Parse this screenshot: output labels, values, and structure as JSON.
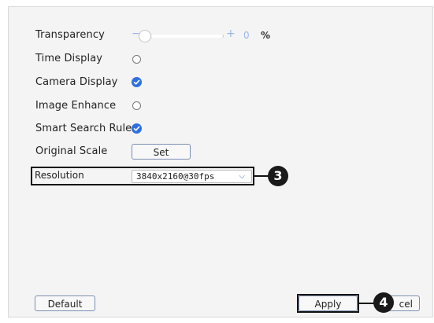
{
  "settings": {
    "transparency": {
      "label": "Transparency",
      "minus": "−",
      "plus": "+",
      "value": "0",
      "unit": "%",
      "level": 0
    },
    "time_display": {
      "label": "Time Display",
      "checked": false
    },
    "camera_display": {
      "label": "Camera Display",
      "checked": true
    },
    "image_enhance": {
      "label": "Image Enhance",
      "checked": false
    },
    "smart_search_rule": {
      "label": "Smart Search Rule",
      "checked": true
    },
    "original_scale": {
      "label": "Original Scale",
      "button": "Set"
    },
    "resolution": {
      "label": "Resolution",
      "selected": "3840x2160@30fps"
    }
  },
  "footer": {
    "default_label": "Default",
    "apply_label": "Apply",
    "cancel_label": "cel"
  },
  "callouts": {
    "resolution": "3",
    "apply": "4"
  },
  "colors": {
    "accent": "#2f6fe0",
    "badge": "#1a1a1a"
  }
}
